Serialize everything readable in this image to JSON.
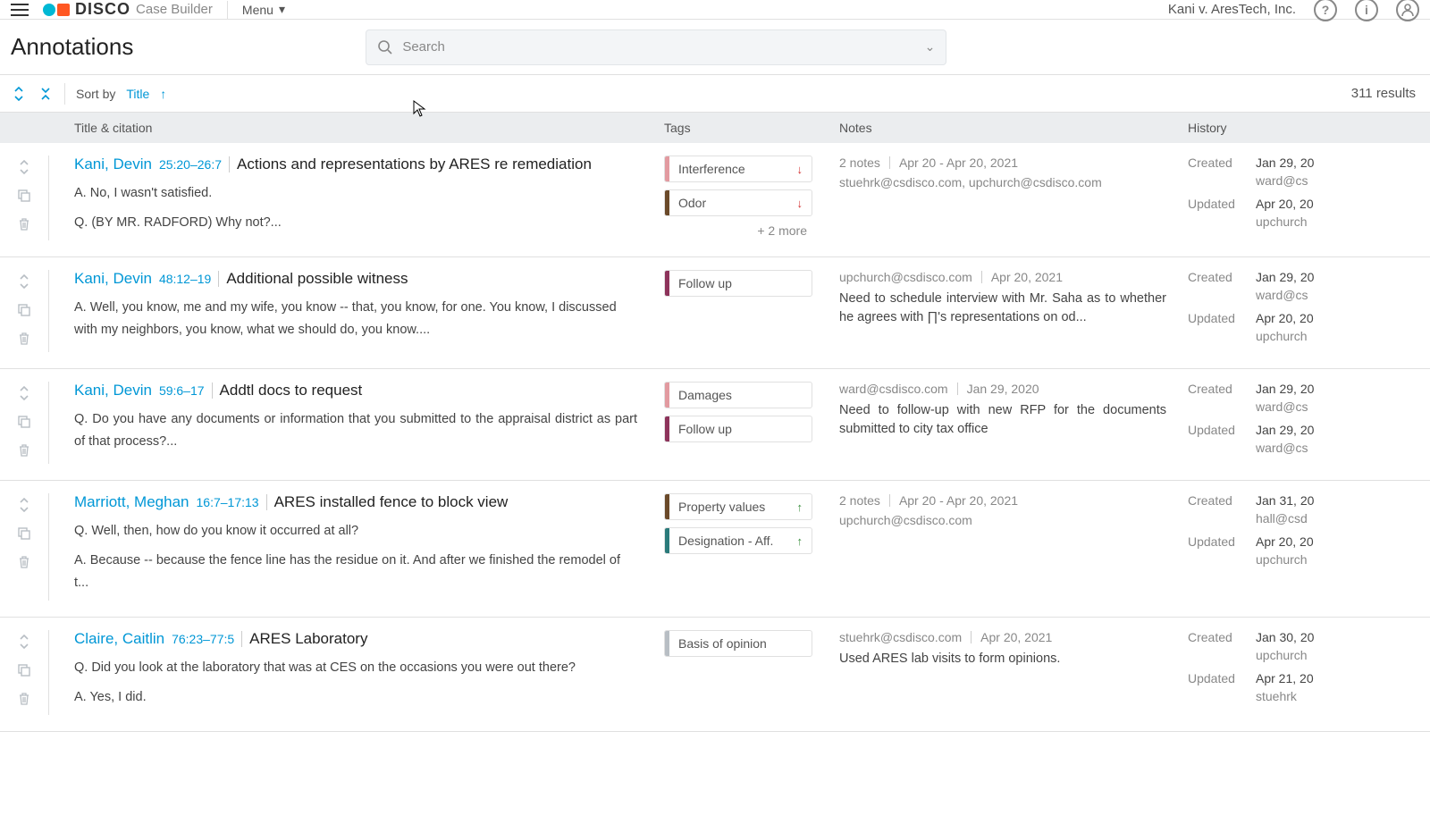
{
  "topbar": {
    "logo_text": "DISCO",
    "logo_sub": "Case Builder",
    "menu_label": "Menu",
    "case_name": "Kani v. AresTech, Inc."
  },
  "header": {
    "page_title": "Annotations",
    "search_placeholder": "Search"
  },
  "sortbar": {
    "sort_by": "Sort by",
    "field": "Title",
    "results": "311 results"
  },
  "columns": {
    "title": "Title & citation",
    "tags": "Tags",
    "notes": "Notes",
    "history": "History"
  },
  "rows": [
    {
      "deponent": "Kani, Devin",
      "citation": "25:20–26:7",
      "title": "Actions and representations by ARES re remediation",
      "excerpt_lines": [
        "A. No, I wasn't satisfied.",
        "Q. (BY MR. RADFORD) Why not?..."
      ],
      "excerpt_justify": false,
      "tags": [
        {
          "label": "Interference",
          "color": "#e29aa0",
          "arrow": "down"
        },
        {
          "label": "Odor",
          "color": "#6b4a2a",
          "arrow": "down"
        }
      ],
      "more_tags": "+ 2 more",
      "notes": {
        "meta1": "2 notes",
        "meta2": "Apr 20 - Apr 20, 2021",
        "author": "stuehrk@csdisco.com, upchurch@csdisco.com",
        "body": ""
      },
      "history": {
        "created_date": "Jan 29, 20",
        "created_by": "ward@cs",
        "updated_date": "Apr 20, 20",
        "updated_by": "upchurch"
      }
    },
    {
      "deponent": "Kani, Devin",
      "citation": "48:12–19",
      "title": "Additional possible witness",
      "excerpt_lines": [
        "A. Well, you know, me and my wife, you know -- that, you know, for one. You know, I discussed with my neighbors, you know, what we should do, you know...."
      ],
      "excerpt_justify": false,
      "tags": [
        {
          "label": "Follow up",
          "color": "#8d335b",
          "arrow": ""
        }
      ],
      "more_tags": "",
      "notes": {
        "meta1": "upchurch@csdisco.com",
        "meta2": "Apr 20, 2021",
        "author": "",
        "body": "Need to schedule interview with Mr. Saha as to whether he agrees with ∏'s representations on od..."
      },
      "history": {
        "created_date": "Jan 29, 20",
        "created_by": "ward@cs",
        "updated_date": "Apr 20, 20",
        "updated_by": "upchurch"
      }
    },
    {
      "deponent": "Kani, Devin",
      "citation": "59:6–17",
      "title": "Addtl docs to request",
      "excerpt_lines": [
        "Q. Do you have any documents or information that you submitted to the appraisal district as part of that process?..."
      ],
      "excerpt_justify": true,
      "tags": [
        {
          "label": "Damages",
          "color": "#e29aa0",
          "arrow": ""
        },
        {
          "label": "Follow up",
          "color": "#8d335b",
          "arrow": ""
        }
      ],
      "more_tags": "",
      "notes": {
        "meta1": "ward@csdisco.com",
        "meta2": "Jan 29, 2020",
        "author": "",
        "body": "Need to follow-up with new RFP for the documents submitted to city tax office"
      },
      "history": {
        "created_date": "Jan 29, 20",
        "created_by": "ward@cs",
        "updated_date": "Jan 29, 20",
        "updated_by": "ward@cs"
      }
    },
    {
      "deponent": "Marriott, Meghan",
      "citation": "16:7–17:13",
      "title": "ARES installed fence to block view",
      "excerpt_lines": [
        "Q. Well, then, how do you know it occurred at all?",
        "A. Because -- because the fence line has the residue on it. And after we finished the remodel of t..."
      ],
      "excerpt_justify": false,
      "tags": [
        {
          "label": "Property values",
          "color": "#6b4a2a",
          "arrow": "up"
        },
        {
          "label": "Designation - Aff.",
          "color": "#2a7a7a",
          "arrow": "up"
        }
      ],
      "more_tags": "",
      "notes": {
        "meta1": "2 notes",
        "meta2": "Apr 20 - Apr 20, 2021",
        "author": "upchurch@csdisco.com",
        "body": ""
      },
      "history": {
        "created_date": "Jan 31, 20",
        "created_by": "hall@csd",
        "updated_date": "Apr 20, 20",
        "updated_by": "upchurch"
      }
    },
    {
      "deponent": "Claire, Caitlin",
      "citation": "76:23–77:5",
      "title": "ARES Laboratory",
      "excerpt_lines": [
        "Q. Did you look at the laboratory that was at CES on the occasions you were out there?",
        "A. Yes, I did."
      ],
      "excerpt_justify": false,
      "tags": [
        {
          "label": "Basis of opinion",
          "color": "#b8bec4",
          "arrow": ""
        }
      ],
      "more_tags": "",
      "notes": {
        "meta1": "stuehrk@csdisco.com",
        "meta2": "Apr 20, 2021",
        "author": "",
        "body": "Used ARES lab visits to form opinions."
      },
      "history": {
        "created_date": "Jan 30, 20",
        "created_by": "upchurch",
        "updated_date": "Apr 21, 20",
        "updated_by": "stuehrk"
      }
    }
  ]
}
